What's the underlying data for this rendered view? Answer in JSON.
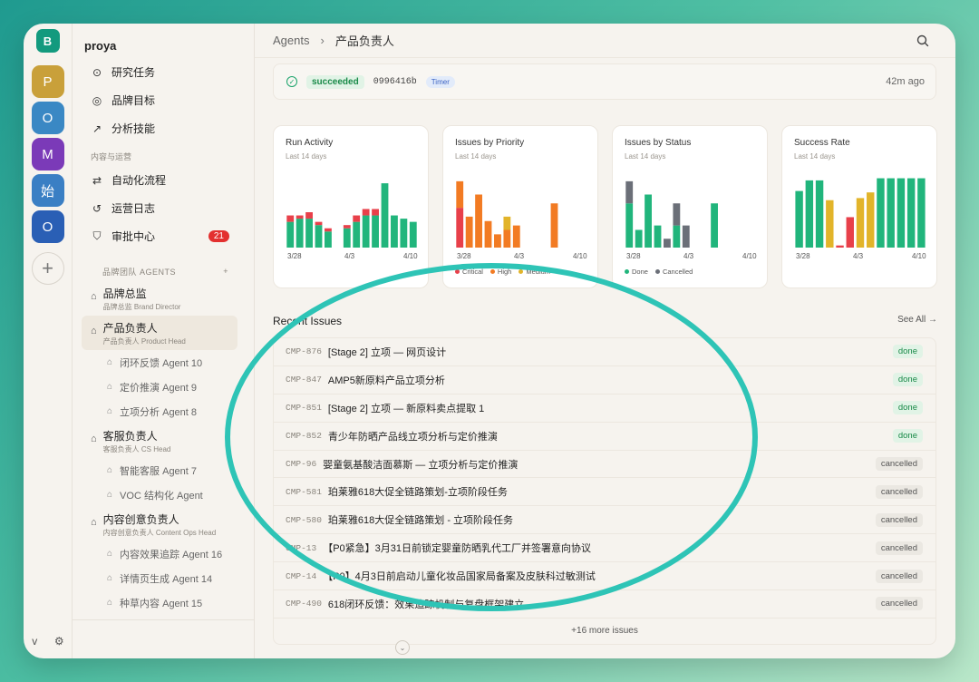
{
  "workspace": {
    "top_initial": "B",
    "add_label": "+"
  },
  "rail_avatars": [
    {
      "initial": "P",
      "bg": "#c9a03a"
    },
    {
      "initial": "O",
      "bg": "#3a88c4"
    },
    {
      "initial": "M",
      "bg": "#7b3ab8"
    },
    {
      "initial": "始",
      "bg": "#3a7fc4"
    },
    {
      "initial": "O",
      "bg": "#2a5fb5"
    }
  ],
  "rail_bottom": {
    "collapse": "v",
    "settings_icon": "⚙"
  },
  "sidebar": {
    "org_name": "proya",
    "nav": [
      {
        "icon": "⊙",
        "label": "研究任务"
      },
      {
        "icon": "◎",
        "label": "品牌目标"
      },
      {
        "icon": "↗",
        "label": "分析技能"
      }
    ],
    "section_label": "内容与运营",
    "nav2": [
      {
        "icon": "⇄",
        "label": "自动化流程"
      },
      {
        "icon": "↺",
        "label": "运营日志"
      },
      {
        "icon": "⛉",
        "label": "审批中心",
        "badge": "21"
      }
    ],
    "agents_label": "品牌团队 AGENTS",
    "agents_add": "+",
    "agents": [
      {
        "name": "品牌总监",
        "desc": "品牌总监 Brand Director"
      },
      {
        "name": "产品负责人",
        "desc": "产品负责人 Product Head"
      }
    ],
    "subs1": [
      "闭环反馈 Agent 10",
      "定价推演 Agent 9",
      "立项分析 Agent 8"
    ],
    "agent3": {
      "name": "客服负责人",
      "desc": "客服负责人 CS Head"
    },
    "subs2": [
      "智能客服 Agent 7",
      "VOC 结构化 Agent"
    ],
    "agent4": {
      "name": "内容创意负责人",
      "desc": "内容创意负责人 Content Ops Head"
    },
    "subs3": [
      "内容效果追踪 Agent 16",
      "详情页生成 Agent 14",
      "种草内容 Agent 15"
    ]
  },
  "topbar": {
    "crumb1": "Agents",
    "sep": "›",
    "crumb2": "产品负责人"
  },
  "run": {
    "status": "succeeded",
    "hash": "0996416b",
    "tag": "Timer",
    "time": "42m ago"
  },
  "colors": {
    "green": "#21b57c",
    "red": "#e8404a",
    "orange": "#f27b23",
    "yellow": "#e2b42a",
    "gray": "#6b6f78"
  },
  "chart_data": [
    {
      "type": "bar",
      "title": "Run Activity",
      "subtitle": "Last 14 days",
      "x_ticks": [
        "3/28",
        "4/3",
        "4/10"
      ],
      "series": [
        {
          "values": [
            8,
            9,
            9,
            7,
            5,
            0,
            6,
            8,
            10,
            10,
            20,
            10,
            9,
            8
          ]
        },
        {
          "values": [
            2,
            1,
            2,
            1,
            1,
            0,
            1,
            2,
            2,
            2,
            0,
            0,
            0,
            0
          ]
        }
      ],
      "series_colors": [
        "#21b57c",
        "#e8404a"
      ],
      "ylim": [
        0,
        22
      ]
    },
    {
      "type": "bar",
      "title": "Issues by Priority",
      "subtitle": "Last 14 days",
      "x_ticks": [
        "3/28",
        "4/3",
        "4/10"
      ],
      "bars": [
        {
          "segments": [
            [
              "#e8404a",
              9
            ],
            [
              "#f27b23",
              6
            ]
          ]
        },
        {
          "segments": [
            [
              "#f27b23",
              7
            ]
          ]
        },
        {
          "segments": [
            [
              "#f27b23",
              12
            ]
          ]
        },
        {
          "segments": [
            [
              "#f27b23",
              6
            ]
          ]
        },
        {
          "segments": [
            [
              "#f27b23",
              3
            ]
          ]
        },
        {
          "segments": [
            [
              "#f27b23",
              4
            ],
            [
              "#e2b42a",
              3
            ]
          ]
        },
        {
          "segments": [
            [
              "#f27b23",
              5
            ]
          ]
        },
        {
          "segments": [
            [
              "#f27b23",
              0
            ]
          ]
        },
        {
          "segments": [
            [
              "#f27b23",
              0
            ]
          ]
        },
        {
          "segments": [
            [
              "#f27b23",
              0
            ]
          ]
        },
        {
          "segments": [
            [
              "#f27b23",
              10
            ]
          ]
        },
        {
          "segments": [
            [
              "#f27b23",
              0
            ]
          ]
        },
        {
          "segments": [
            [
              "#f27b23",
              0
            ]
          ]
        },
        {
          "segments": [
            [
              "#f27b23",
              0
            ]
          ]
        }
      ],
      "ylim": [
        0,
        16
      ],
      "legend": [
        {
          "name": "Critical",
          "color": "#e8404a"
        },
        {
          "name": "High",
          "color": "#f27b23"
        },
        {
          "name": "Medium",
          "color": "#e2b42a"
        }
      ]
    },
    {
      "type": "bar",
      "title": "Issues by Status",
      "subtitle": "Last 14 days",
      "x_ticks": [
        "3/28",
        "4/3",
        "4/10"
      ],
      "bars": [
        {
          "segments": [
            [
              "#21b57c",
              10
            ],
            [
              "#6b6f78",
              5
            ]
          ]
        },
        {
          "segments": [
            [
              "#21b57c",
              4
            ]
          ]
        },
        {
          "segments": [
            [
              "#21b57c",
              12
            ]
          ]
        },
        {
          "segments": [
            [
              "#21b57c",
              5
            ]
          ]
        },
        {
          "segments": [
            [
              "#6b6f78",
              2
            ]
          ]
        },
        {
          "segments": [
            [
              "#21b57c",
              5
            ],
            [
              "#6b6f78",
              5
            ]
          ]
        },
        {
          "segments": [
            [
              "#6b6f78",
              5
            ]
          ]
        },
        {
          "segments": [
            [
              "#21b57c",
              0
            ]
          ]
        },
        {
          "segments": [
            [
              "#21b57c",
              0
            ]
          ]
        },
        {
          "segments": [
            [
              "#21b57c",
              10
            ]
          ]
        },
        {
          "segments": [
            [
              "#21b57c",
              0
            ]
          ]
        },
        {
          "segments": [
            [
              "#21b57c",
              0
            ]
          ]
        },
        {
          "segments": [
            [
              "#21b57c",
              0
            ]
          ]
        },
        {
          "segments": [
            [
              "#21b57c",
              0
            ]
          ]
        }
      ],
      "ylim": [
        0,
        16
      ],
      "legend": [
        {
          "name": "Done",
          "color": "#21b57c"
        },
        {
          "name": "Cancelled",
          "color": "#6b6f78"
        }
      ]
    },
    {
      "type": "bar",
      "title": "Success Rate",
      "subtitle": "Last 14 days",
      "x_ticks": [
        "3/28",
        "4/3",
        "4/10"
      ],
      "bars": [
        {
          "segments": [
            [
              "#21b57c",
              80
            ]
          ]
        },
        {
          "segments": [
            [
              "#21b57c",
              95
            ]
          ]
        },
        {
          "segments": [
            [
              "#21b57c",
              95
            ]
          ]
        },
        {
          "segments": [
            [
              "#e2b42a",
              67
            ]
          ]
        },
        {
          "segments": [
            [
              "#e8404a",
              3
            ]
          ]
        },
        {
          "segments": [
            [
              "#e8404a",
              43
            ]
          ]
        },
        {
          "segments": [
            [
              "#e2b42a",
              70
            ]
          ]
        },
        {
          "segments": [
            [
              "#e2b42a",
              78
            ]
          ]
        },
        {
          "segments": [
            [
              "#21b57c",
              98
            ]
          ]
        },
        {
          "segments": [
            [
              "#21b57c",
              98
            ]
          ]
        },
        {
          "segments": [
            [
              "#21b57c",
              98
            ]
          ]
        },
        {
          "segments": [
            [
              "#21b57c",
              98
            ]
          ]
        },
        {
          "segments": [
            [
              "#21b57c",
              98
            ]
          ]
        }
      ],
      "ylim": [
        0,
        100
      ]
    }
  ],
  "recent": {
    "title": "Recent Issues",
    "see_all": "See All →",
    "issues": [
      {
        "id": "CMP-876",
        "title": "[Stage 2] 立项 — 网页设计",
        "status": "done"
      },
      {
        "id": "CMP-847",
        "title": "AMP5新原料产品立项分析",
        "status": "done"
      },
      {
        "id": "CMP-851",
        "title": "[Stage 2] 立项 — 新原料卖点提取 1",
        "status": "done"
      },
      {
        "id": "CMP-852",
        "title": "青少年防晒产品线立项分析与定价推演",
        "status": "done"
      },
      {
        "id": "CMP-96",
        "title": "婴童氨基酸洁面慕斯 — 立项分析与定价推演",
        "status": "cancelled"
      },
      {
        "id": "CMP-581",
        "title": "珀莱雅618大促全链路策划-立项阶段任务",
        "status": "cancelled"
      },
      {
        "id": "CMP-580",
        "title": "珀莱雅618大促全链路策划 - 立项阶段任务",
        "status": "cancelled"
      },
      {
        "id": "CMP-13",
        "title": "【P0紧急】3月31日前锁定婴童防晒乳代工厂并签署意向协议",
        "status": "cancelled"
      },
      {
        "id": "CMP-14",
        "title": "【P0】4月3日前启动儿童化妆品国家局备案及皮肤科过敏测试",
        "status": "cancelled"
      },
      {
        "id": "CMP-490",
        "title": "618闭环反馈：效果追踪机制与复盘框架建立",
        "status": "cancelled"
      }
    ],
    "more": "+16 more issues"
  }
}
